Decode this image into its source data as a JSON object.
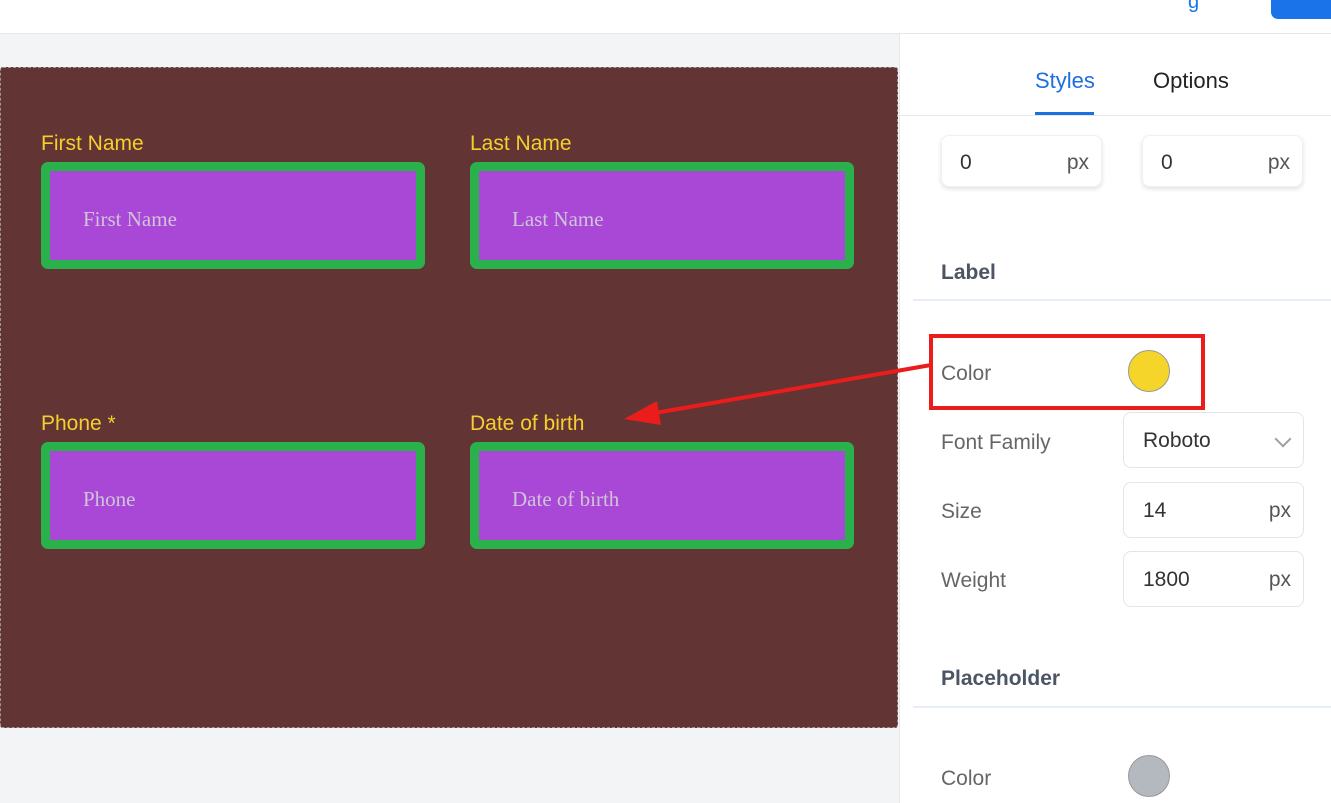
{
  "header": {
    "link_partial": "g"
  },
  "form": {
    "fields": [
      {
        "label": "First Name",
        "placeholder": "First Name"
      },
      {
        "label": "Last Name",
        "placeholder": "Last Name"
      },
      {
        "label": "Phone  *",
        "placeholder": "Phone"
      },
      {
        "label": "Date of birth",
        "placeholder": "Date of birth"
      }
    ]
  },
  "panel": {
    "tabs": [
      {
        "label": "Styles",
        "active": true
      },
      {
        "label": "Options",
        "active": false
      }
    ],
    "spacing": {
      "left_value": "0",
      "right_value": "0",
      "unit": "px"
    },
    "label_section": {
      "title": "Label",
      "color_label": "Color",
      "color_value": "#f5d52a",
      "font_family_label": "Font Family",
      "font_family_value": "Roboto",
      "size_label": "Size",
      "size_value": "14",
      "size_unit": "px",
      "weight_label": "Weight",
      "weight_value": "1800",
      "weight_unit": "px"
    },
    "placeholder_section": {
      "title": "Placeholder",
      "color_label": "Color",
      "color_value": "#b3b9bf"
    }
  },
  "colors": {
    "accent": "#1b6fe0",
    "form_background": "#623534",
    "input_fill": "#a947d6",
    "input_border": "#2bb14b",
    "label_text": "#f5cf2e",
    "annotation": "#ea1c1c"
  }
}
